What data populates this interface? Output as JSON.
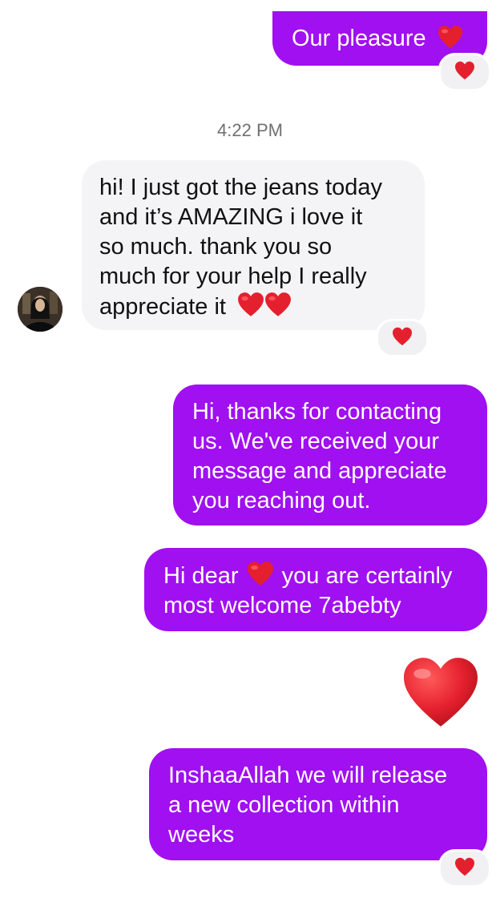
{
  "messages": {
    "m1": {
      "text": "Our pleasure",
      "reaction": "heart-icon"
    },
    "timestamp": "4:22 PM",
    "m2": {
      "lines": [
        "hi! I just got the jeans today",
        "and it’s AMAZING i love it",
        "so much. thank you so",
        "much for your help I really",
        "appreciate it"
      ],
      "reaction": "heart-icon"
    },
    "m3": {
      "lines": [
        "Hi, thanks for contacting",
        "us. We've received your",
        "message and appreciate",
        "you reaching out."
      ]
    },
    "m4": {
      "line1_before": "Hi dear",
      "line1_after": "you are certainly",
      "line2": "most welcome 7abebty"
    },
    "m5": {
      "emoji": "red-heart"
    },
    "m6": {
      "lines": [
        "InshaaAllah we will release",
        "a new collection within",
        "weeks"
      ],
      "reaction": "heart-icon"
    }
  },
  "colors": {
    "outgoing_bubble": "#a010f0",
    "incoming_bubble": "#f4f4f6",
    "heart": "#e5202e"
  }
}
